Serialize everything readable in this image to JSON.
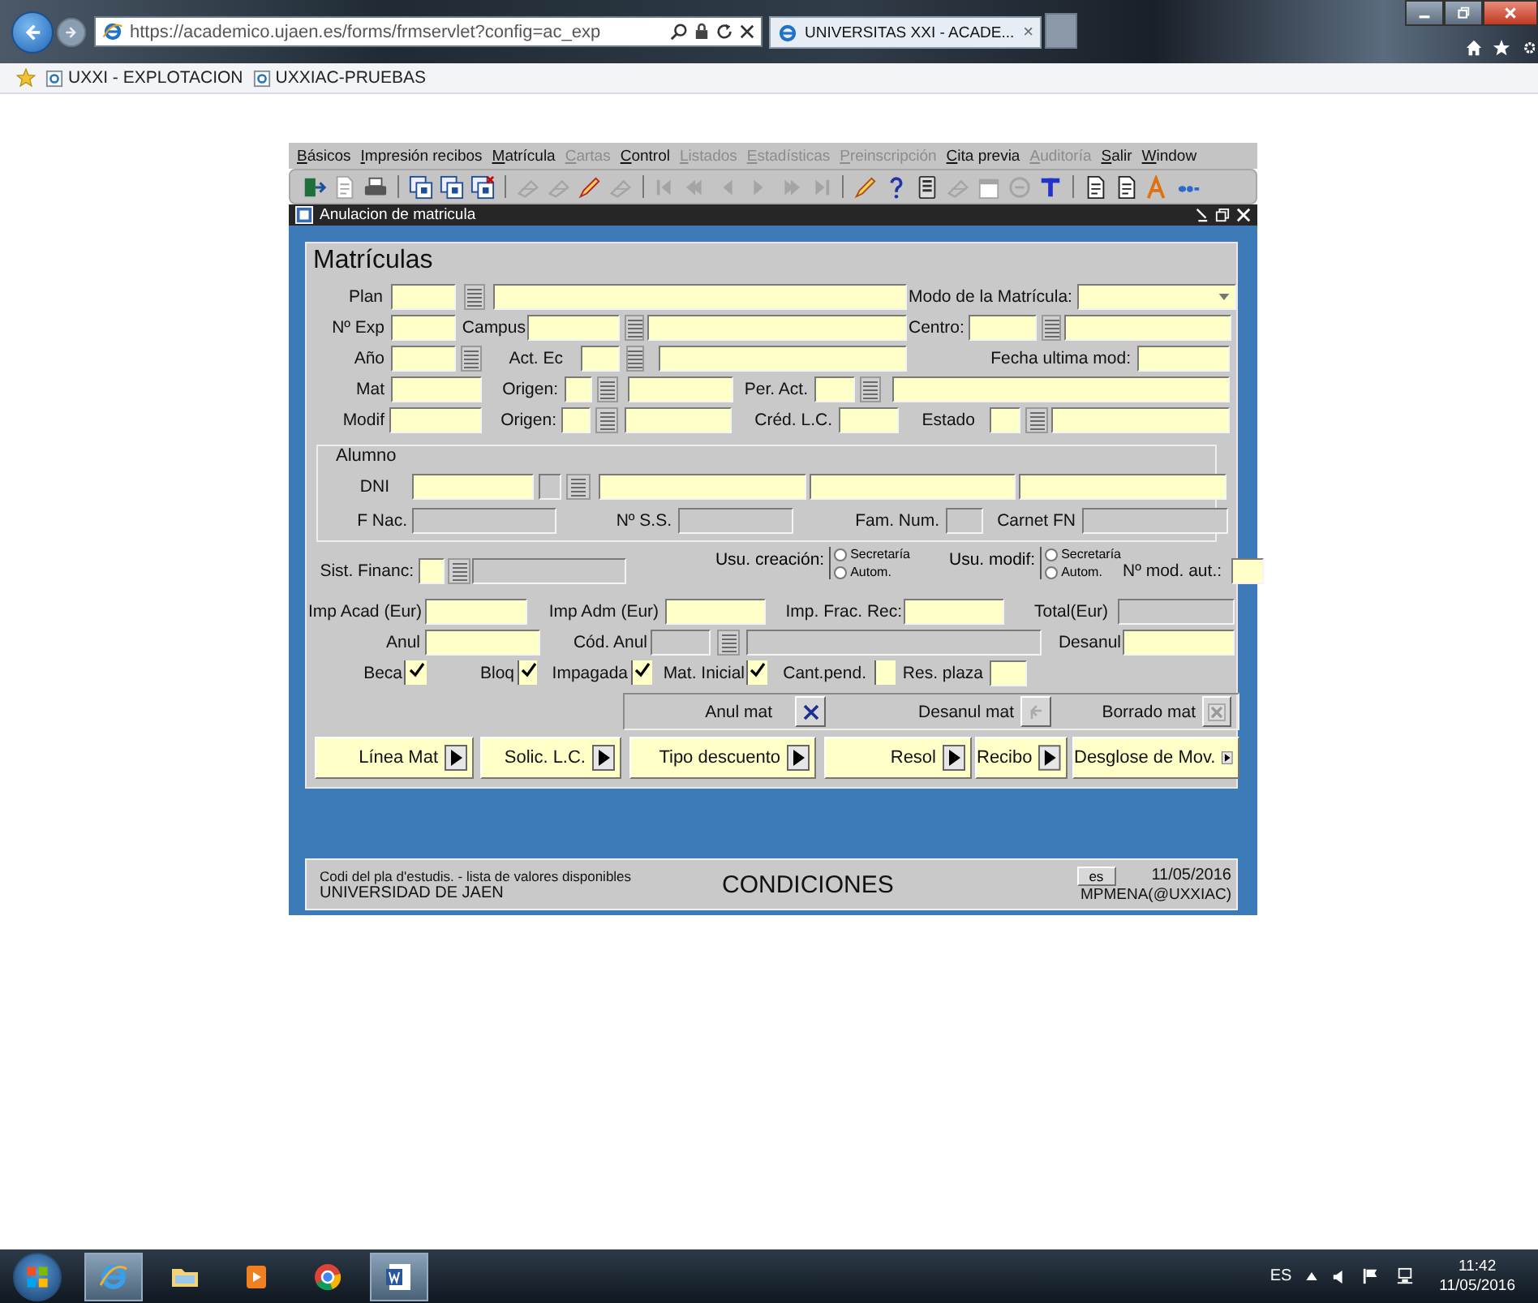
{
  "browser": {
    "address": "https://academico.ujaen.es/forms/frmservlet?config=ac_exp",
    "tab": "UNIVERSITAS XXI - ACADE...",
    "tab_close": "×"
  },
  "favorites": [
    "UXXI - EXPLOTACION",
    "UXXIAC-PRUEBAS"
  ],
  "menu": [
    {
      "label": "Básicos",
      "disabled": false
    },
    {
      "label": "Impresión recibos",
      "disabled": false
    },
    {
      "label": "Matrícula",
      "disabled": false
    },
    {
      "label": "Cartas",
      "disabled": true
    },
    {
      "label": "Control",
      "disabled": false
    },
    {
      "label": "Listados",
      "disabled": true
    },
    {
      "label": "Estadísticas",
      "disabled": true
    },
    {
      "label": "Preinscripción",
      "disabled": true
    },
    {
      "label": "Cita previa",
      "disabled": false
    },
    {
      "label": "Auditoría",
      "disabled": true
    },
    {
      "label": "Salir",
      "disabled": false
    },
    {
      "label": "Window",
      "disabled": false
    }
  ],
  "toolbar": [
    {
      "kind": "exit",
      "disabled": false
    },
    {
      "kind": "save",
      "disabled": true
    },
    {
      "kind": "print",
      "disabled": false
    },
    {
      "kind": "sep"
    },
    {
      "kind": "query",
      "disabled": false
    },
    {
      "kind": "query",
      "disabled": false
    },
    {
      "kind": "query-clear",
      "disabled": false
    },
    {
      "kind": "sep"
    },
    {
      "kind": "insert",
      "disabled": true
    },
    {
      "kind": "delete",
      "disabled": true
    },
    {
      "kind": "edit",
      "disabled": false
    },
    {
      "kind": "clear",
      "disabled": true
    },
    {
      "kind": "sep"
    },
    {
      "kind": "first",
      "disabled": true
    },
    {
      "kind": "prev-set",
      "disabled": true
    },
    {
      "kind": "prev",
      "disabled": true
    },
    {
      "kind": "next",
      "disabled": true
    },
    {
      "kind": "next-set",
      "disabled": true
    },
    {
      "kind": "last",
      "disabled": true
    },
    {
      "kind": "sep"
    },
    {
      "kind": "pencil",
      "disabled": false
    },
    {
      "kind": "help",
      "disabled": false
    },
    {
      "kind": "list",
      "disabled": false
    },
    {
      "kind": "tool",
      "disabled": true
    },
    {
      "kind": "calendar",
      "disabled": true
    },
    {
      "kind": "circle",
      "disabled": true
    },
    {
      "kind": "text",
      "disabled": false
    },
    {
      "kind": "sep"
    },
    {
      "kind": "doc",
      "disabled": false
    },
    {
      "kind": "doc",
      "disabled": false
    },
    {
      "kind": "font",
      "disabled": false
    },
    {
      "kind": "dots",
      "disabled": false
    }
  ],
  "window": {
    "title": "Anulacion de matricula"
  },
  "form": {
    "title": "Matrículas",
    "rows_top": [
      [
        {
          "kind": "label",
          "text": "Plan"
        },
        {
          "kind": "field",
          "disabled": false
        },
        {
          "kind": "lov"
        },
        {
          "kind": "field",
          "disabled": false
        },
        {
          "kind": "label",
          "text": "Modo de la Matrícula:"
        },
        {
          "kind": "select"
        }
      ],
      [
        {
          "kind": "label",
          "text": "Nº Exp"
        },
        {
          "kind": "field",
          "disabled": false
        },
        {
          "kind": "label",
          "text": "Campus"
        },
        {
          "kind": "field",
          "disabled": false
        },
        {
          "kind": "lov"
        },
        {
          "kind": "field",
          "disabled": false
        },
        {
          "kind": "label",
          "text": "Centro:"
        },
        {
          "kind": "field",
          "disabled": false
        },
        {
          "kind": "lov"
        },
        {
          "kind": "field",
          "disabled": false
        }
      ],
      [
        {
          "kind": "label",
          "text": "Año"
        },
        {
          "kind": "field",
          "disabled": false
        },
        {
          "kind": "lov"
        },
        {
          "kind": "label",
          "text": "Act. Ec"
        },
        {
          "kind": "field",
          "disabled": false
        },
        {
          "kind": "lov"
        },
        {
          "kind": "field",
          "disabled": false
        },
        {
          "kind": "label",
          "text": "Fecha ultima mod:"
        },
        {
          "kind": "field",
          "disabled": false
        }
      ],
      [
        {
          "kind": "label",
          "text": "Mat"
        },
        {
          "kind": "field",
          "disabled": false
        },
        {
          "kind": "label",
          "text": "Origen:"
        },
        {
          "kind": "field",
          "disabled": false
        },
        {
          "kind": "lov"
        },
        {
          "kind": "field",
          "disabled": false
        },
        {
          "kind": "label",
          "text": "Per. Act."
        },
        {
          "kind": "field",
          "disabled": false
        },
        {
          "kind": "lov"
        },
        {
          "kind": "field",
          "disabled": false
        }
      ],
      [
        {
          "kind": "label",
          "text": "Modif"
        },
        {
          "kind": "field",
          "disabled": false
        },
        {
          "kind": "label",
          "text": "Origen:"
        },
        {
          "kind": "field",
          "disabled": false
        },
        {
          "kind": "lov"
        },
        {
          "kind": "field",
          "disabled": false
        },
        {
          "kind": "label",
          "text": "Créd. L.C."
        },
        {
          "kind": "field",
          "disabled": false
        },
        {
          "kind": "label",
          "text": "Estado"
        },
        {
          "kind": "field",
          "disabled": false
        },
        {
          "kind": "lov"
        },
        {
          "kind": "field",
          "disabled": false
        }
      ]
    ],
    "student": {
      "title": "Alumno",
      "rows": [
        [
          {
            "kind": "label",
            "text": "DNI"
          },
          {
            "kind": "field",
            "disabled": false
          },
          {
            "kind": "field",
            "disabled": true
          },
          {
            "kind": "lov"
          },
          {
            "kind": "field",
            "disabled": false
          },
          {
            "kind": "field",
            "disabled": false
          },
          {
            "kind": "field",
            "disabled": false
          }
        ],
        [
          {
            "kind": "label",
            "text": "F Nac."
          },
          {
            "kind": "field",
            "disabled": true
          },
          {
            "kind": "label",
            "text": "Nº S.S."
          },
          {
            "kind": "field",
            "disabled": true
          },
          {
            "kind": "label",
            "text": "Fam. Num."
          },
          {
            "kind": "field",
            "disabled": true
          },
          {
            "kind": "label",
            "text": "Carnet FN"
          },
          {
            "kind": "field",
            "disabled": true
          }
        ]
      ]
    },
    "rows_bottom": [
      [
        {
          "kind": "label",
          "text": "Sist. Financ:"
        },
        {
          "kind": "field",
          "disabled": false
        },
        {
          "kind": "lov"
        },
        {
          "kind": "field",
          "disabled": true
        },
        {
          "kind": "radios",
          "label": "Usu. creación:",
          "options": [
            {
              "label": "Secretaría",
              "selected": false
            },
            {
              "label": "Autom.",
              "selected": false
            }
          ]
        },
        {
          "kind": "radios",
          "label": "Usu. modif:",
          "options": [
            {
              "label": "Secretaría",
              "selected": false
            },
            {
              "label": "Autom.",
              "selected": false
            }
          ]
        },
        {
          "kind": "label",
          "text": "Nº mod. aut.:"
        },
        {
          "kind": "field",
          "disabled": false
        }
      ],
      [
        {
          "kind": "label",
          "text": "Imp Acad (Eur)"
        },
        {
          "kind": "field",
          "disabled": false
        },
        {
          "kind": "label",
          "text": "Imp Adm (Eur)"
        },
        {
          "kind": "field",
          "disabled": false
        },
        {
          "kind": "label",
          "text": "Imp. Frac. Rec:"
        },
        {
          "kind": "field",
          "disabled": false
        },
        {
          "kind": "label",
          "text": "Total(Eur)"
        },
        {
          "kind": "field",
          "disabled": true
        }
      ],
      [
        {
          "kind": "label",
          "text": "Anul"
        },
        {
          "kind": "field",
          "disabled": false
        },
        {
          "kind": "label",
          "text": "Cód. Anul"
        },
        {
          "kind": "field",
          "disabled": true
        },
        {
          "kind": "lov"
        },
        {
          "kind": "field",
          "disabled": true
        },
        {
          "kind": "label",
          "text": "Desanul"
        },
        {
          "kind": "field",
          "disabled": false
        }
      ],
      [
        {
          "kind": "label",
          "text": "Beca"
        },
        {
          "kind": "checkbox",
          "checked": true
        },
        {
          "kind": "label",
          "text": "Bloq"
        },
        {
          "kind": "checkbox",
          "checked": true
        },
        {
          "kind": "label",
          "text": "Impagada"
        },
        {
          "kind": "checkbox",
          "checked": true
        },
        {
          "kind": "label",
          "text": "Mat. Inicial"
        },
        {
          "kind": "checkbox",
          "checked": true
        },
        {
          "kind": "label",
          "text": "Cant.pend."
        },
        {
          "kind": "checkbox",
          "checked": false
        },
        {
          "kind": "label",
          "text": "Res. plaza"
        },
        {
          "kind": "field",
          "disabled": false
        }
      ]
    ]
  },
  "actions": [
    {
      "label": "Anul mat",
      "kind": "cancel",
      "disabled": false
    },
    {
      "label": "Desanul mat",
      "kind": "undo",
      "disabled": true
    },
    {
      "label": "Borrado mat",
      "kind": "delete",
      "disabled": true
    }
  ],
  "buttons": [
    "Línea Mat",
    "Solic. L.C.",
    "Tipo descuento",
    "Resol",
    "Recibo",
    "Desglose de Mov."
  ],
  "status": {
    "hint": "Codi del pla d'estudis. - lista de valores disponibles",
    "org": "UNIVERSIDAD DE JAEN",
    "mode": "CONDICIONES",
    "lang": "es",
    "date": "11/05/2016",
    "user": "MPMENA(@UXXIAC)"
  },
  "taskbar": {
    "apps": [
      {
        "kind": "ie",
        "running": true
      },
      {
        "kind": "folder",
        "running": false
      },
      {
        "kind": "media",
        "running": false
      },
      {
        "kind": "chrome",
        "running": false
      },
      {
        "kind": "word",
        "running": true
      }
    ],
    "lang": "ES",
    "time": "11:42",
    "date": "11/05/2016"
  }
}
